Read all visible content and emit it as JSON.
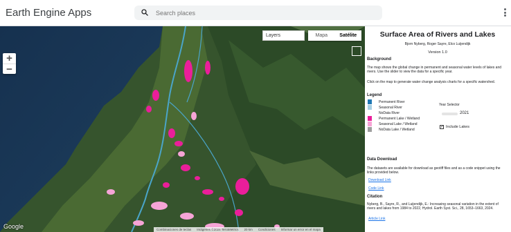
{
  "app": {
    "title": "Earth Engine Apps"
  },
  "search": {
    "placeholder": "Search places"
  },
  "map": {
    "layers_label": "Layers",
    "map_type": {
      "map_label": "Mapa",
      "satellite_label": "Satélite",
      "active": "Satélite"
    },
    "zoom_in": "+",
    "zoom_out": "−",
    "google_label": "Google",
    "attribution": [
      "Combinaciones de teclas",
      "Imágenes ©2024 TerraMetrics",
      "20 km",
      "Condiciones",
      "Informar un error en el mapa"
    ],
    "colors": {
      "permanent_lake": "#ea1e9a",
      "seasonal_lake": "#f6a4d6",
      "permanent_river": "#1f78b4",
      "seasonal_river": "#a6cee3"
    }
  },
  "panel": {
    "title": "Surface Area of Rivers and Lakes",
    "authors": "Bjorn Nyberg, Roger Sayre, Elco Luijendijk",
    "version": "Version 1.0",
    "background_heading": "Background",
    "background_text": "The map shows the global change in permanent and seasonal water levels of lakes and rivers. Use the slider to view the data for a specific year.",
    "click_text": "Click on the map to generate water change analysis charts for a specific watershed.",
    "legend_heading": "Legend",
    "legend": [
      {
        "label": "Permanent River",
        "color": "#1f78b4"
      },
      {
        "label": "Seasonal River",
        "color": "#a6cee3"
      },
      {
        "label": "NoData River",
        "color": "#ffffff"
      },
      {
        "label": "Permanent Lake / Wetland",
        "color": "#ea1e9a"
      },
      {
        "label": "Seasonal Lake / Wetland",
        "color": "#f6a4d6"
      },
      {
        "label": "NoData Lake / Wetland",
        "color": "#9e9e9e"
      }
    ],
    "year_selector_label": "Year Selector",
    "year_value": "2021",
    "include_lakes_label": "Include Lakes",
    "include_lakes_checked": true,
    "download_heading": "Data Download",
    "download_text": "The datasets are available for download as geotiff files and as a code snippet using the links provided below.",
    "download_link": "Download Link",
    "code_link": "Code Link",
    "citation_heading": "Citation",
    "citation_text": "Nyberg, B., Sayre, R., and Luijendijk, E.: Increasing seasonal variation in the extent of rivers and lakes from 1984 to 2022, Hydrol. Earth Syst. Sci., 28, 1653–1663, 2024.",
    "article_link": "Article Link"
  }
}
